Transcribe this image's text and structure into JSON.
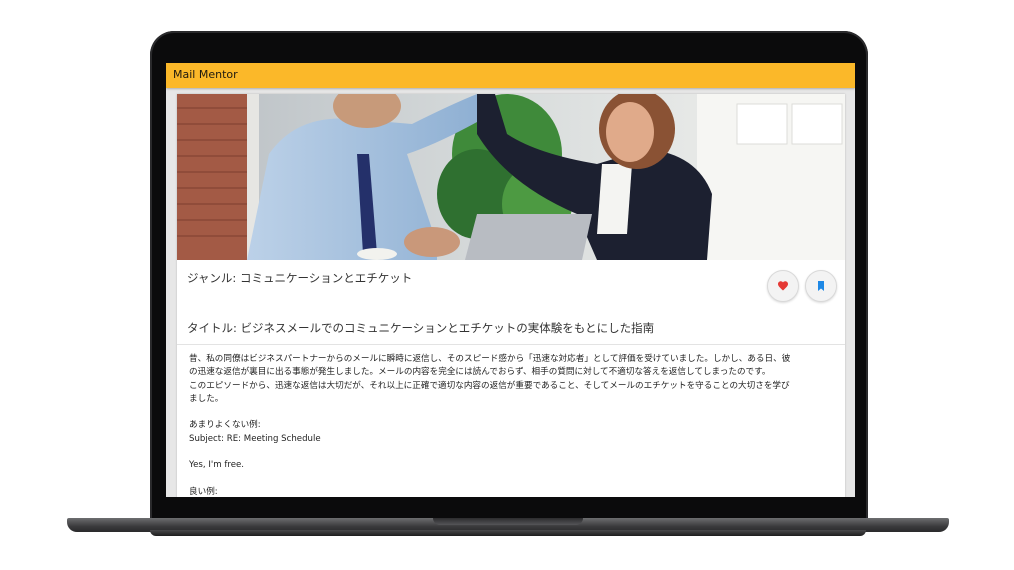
{
  "app": {
    "title": "Mail Mentor"
  },
  "article": {
    "genre": "ジャンル: コミュニケーションとエチケット",
    "title": "タイトル: ビジネスメールでのコミュニケーションとエチケットの実体験をもとにした指南",
    "body": {
      "p1": "昔、私の同僚はビジネスパートナーからのメールに瞬時に返信し、そのスピード感から「迅速な対応者」として評価を受けていました。しかし、ある日、彼",
      "p2": "の迅速な返信が裏目に出る事態が発生しました。メールの内容を完全には読んでおらず、相手の質問に対して不適切な答えを返信してしまったのです。",
      "p3": "このエピソードから、迅速な返信は大切だが、それ以上に正確で適切な内容の返信が重要であること、そしてメールのエチケットを守ることの大切さを学び",
      "p4": "ました。",
      "bad_label": "あまりよくない例:",
      "bad_subject": "Subject: RE: Meeting Schedule",
      "bad_body": "Yes, I'm free.",
      "good_label": "良い例:"
    }
  },
  "icons": {
    "favorite": "heart-icon",
    "bookmark": "bookmark-icon"
  },
  "colors": {
    "appbar": "#fbb829",
    "heart": "#e53935",
    "bookmark": "#1e88e5"
  }
}
